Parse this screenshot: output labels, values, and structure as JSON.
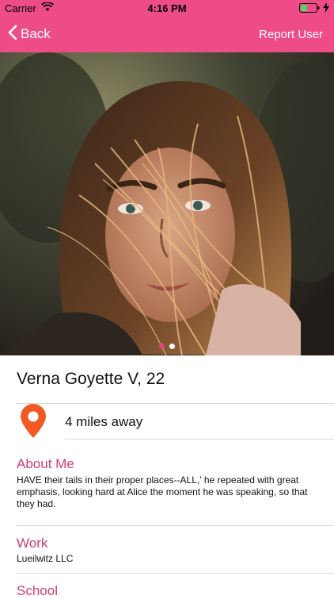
{
  "status_bar": {
    "carrier": "Carrier",
    "time": "4:16 PM"
  },
  "nav": {
    "back_label": "Back",
    "report_label": "Report User"
  },
  "colors": {
    "accent": "#ee4c86",
    "section_title": "#d23c77",
    "pin": "#f15a24"
  },
  "photo": {
    "page_count": 2,
    "current_page": 1
  },
  "profile": {
    "name": "Verna Goyette V, 22",
    "distance": "4 miles away"
  },
  "about": {
    "title": "About Me",
    "text": "HAVE their tails in their proper places--ALL,' he repeated with great emphasis, looking hard at Alice the moment he was speaking, so that they had."
  },
  "work": {
    "title": "Work",
    "text": "Lueilwitz LLC"
  },
  "school": {
    "title": "School"
  }
}
